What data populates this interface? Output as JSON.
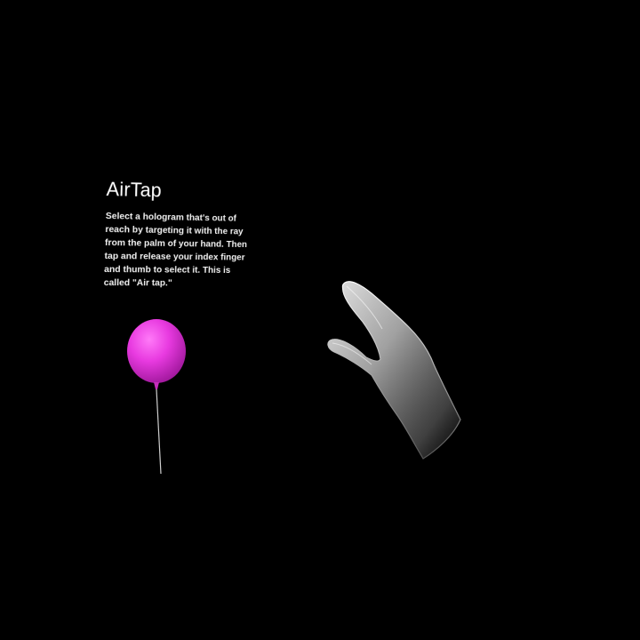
{
  "panel": {
    "title": "AirTap",
    "body": "Select a hologram that's out of reach by targeting it with the ray from the palm of your hand. Then tap and release your index finger and thumb to select it. This is called \"Air tap.\""
  },
  "scene": {
    "background_color": "#000000",
    "balloon_color": "#e83ae0",
    "hand_color": "#d8d8d8"
  },
  "icons": {
    "balloon": "balloon-hologram-icon",
    "hand": "hand-icon"
  }
}
